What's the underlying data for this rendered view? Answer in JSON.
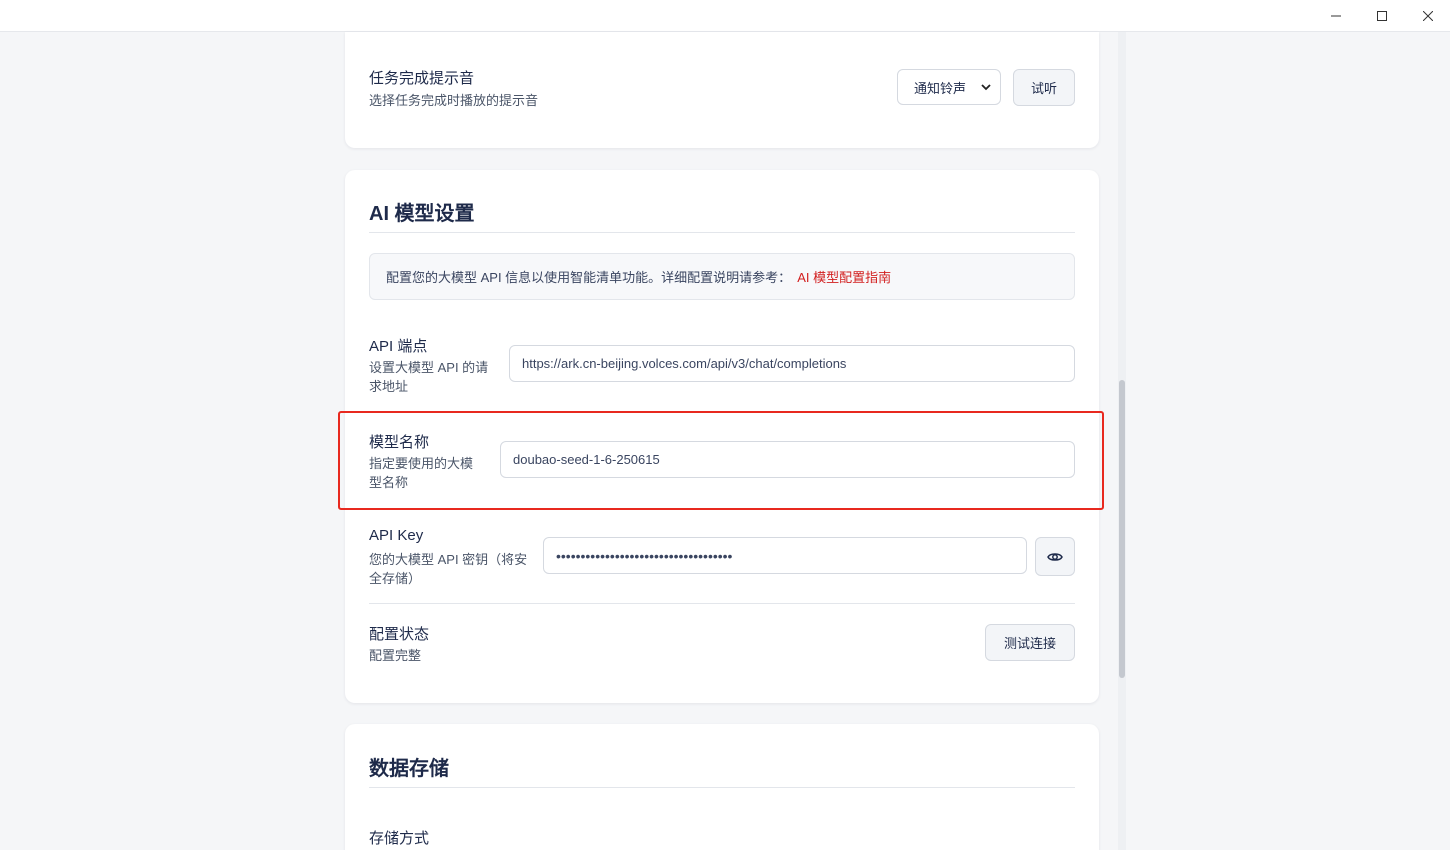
{
  "window": {
    "minimize_icon": "minimize-icon",
    "maximize_icon": "maximize-icon",
    "close_icon": "close-icon"
  },
  "sound": {
    "title": "任务完成提示音",
    "desc": "选择任务完成时播放的提示音",
    "select_value": "通知铃声",
    "listen_label": "试听"
  },
  "ai": {
    "title": "AI 模型设置",
    "notice_text": "配置您的大模型 API 信息以使用智能清单功能。详细配置说明请参考：",
    "notice_link": "AI 模型配置指南",
    "endpoint": {
      "title": "API 端点",
      "desc_line1": "设置大模型 API 的请",
      "desc_line2": "求地址",
      "value": "https://ark.cn-beijing.volces.com/api/v3/chat/completions"
    },
    "model": {
      "title": "模型名称",
      "desc_line1": "指定要使用的大模",
      "desc_line2": "型名称",
      "value": "doubao-seed-1-6-250615"
    },
    "key": {
      "title": "API Key",
      "desc_line1": "您的大模型 API 密钥（将安",
      "desc_line2": "全存储）",
      "value": "••••••••••••••••••••••••••••••••••••",
      "eye_icon": "eye-icon"
    },
    "status": {
      "title": "配置状态",
      "desc": "配置完整",
      "test_label": "测试连接"
    }
  },
  "storage": {
    "title": "数据存储",
    "method_title": "存储方式"
  },
  "colors": {
    "accent_link": "#d21f1f",
    "highlight": "#e8291f",
    "title_text": "#1e2a4a"
  }
}
